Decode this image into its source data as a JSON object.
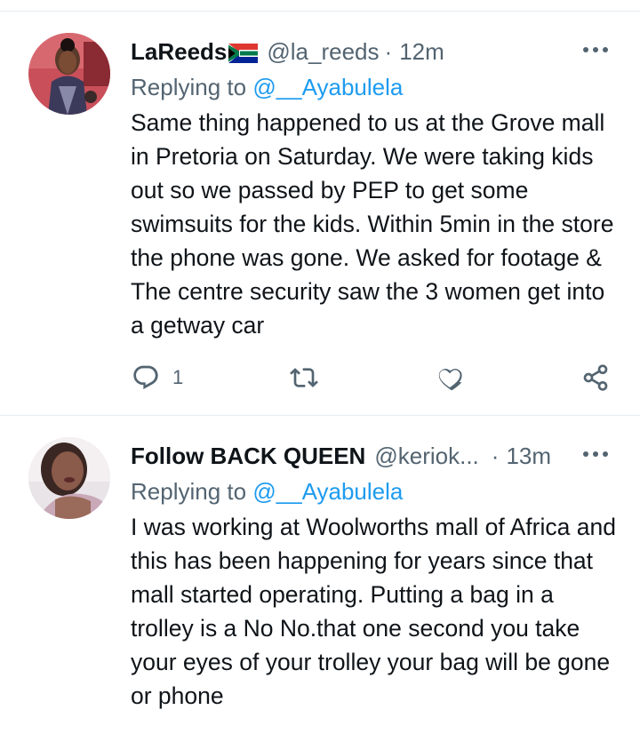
{
  "tweets": [
    {
      "display_name": "LaReeds",
      "flag_icon": "south-africa-flag-icon",
      "handle": "@la_reeds",
      "separator": "·",
      "time": "12m",
      "replying_prefix": "Replying to",
      "replying_to": "@__Ayabulela",
      "body": "Same thing happened to us at the Grove mall in Pretoria on Saturday. We were taking kids out so we passed by PEP to get some swimsuits for the kids. Within 5min in the store the phone was gone. We asked for footage & The centre security saw the 3 women get into a getway car",
      "reply_count": "1",
      "retweet_count": "",
      "like_count": ""
    },
    {
      "display_name": "Follow BACK QUEEN",
      "handle": "@keriok...",
      "separator": "·",
      "time": "13m",
      "replying_prefix": "Replying to",
      "replying_to": "@__Ayabulela",
      "body": "I was working at Woolworths mall of Africa and this has been happening for years since that mall started operating. Putting a bag in a trolley is a No No.that one second you take your eyes of your trolley your bag will be gone or phone"
    }
  ],
  "colors": {
    "text": "#0f1419",
    "secondary": "#536471",
    "accent": "#1d9bf0",
    "divider": "#e6ecf0"
  },
  "icons": [
    "reply-icon",
    "retweet-icon",
    "like-icon",
    "share-icon",
    "more-icon"
  ]
}
